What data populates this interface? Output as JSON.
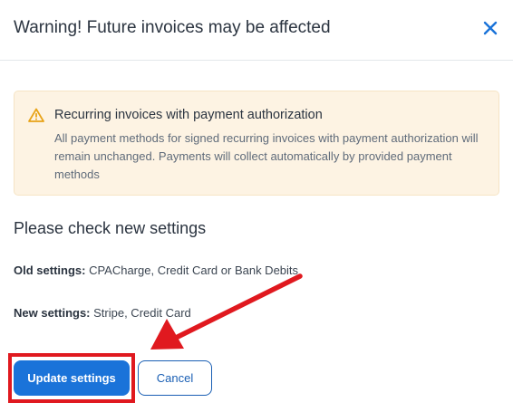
{
  "dialog": {
    "title": "Warning! Future invoices may be affected",
    "close_icon": "close-icon"
  },
  "alert": {
    "icon": "warning-triangle-icon",
    "title": "Recurring invoices with payment authorization",
    "body": "All payment methods for signed recurring invoices with payment authorization will remain unchanged. Payments will collect automatically by provided payment methods"
  },
  "settings": {
    "heading": "Please check new settings",
    "old_label": "Old settings:",
    "old_value": " CPACharge, Credit Card or Bank Debits",
    "new_label": "New settings:",
    "new_value": " Stripe, Credit Card"
  },
  "actions": {
    "update_label": "Update settings",
    "cancel_label": "Cancel"
  },
  "colors": {
    "primary": "#1a73d9",
    "warning_bg": "#fdf3e3",
    "warning_icon": "#e8a317",
    "annotation": "#e0191f"
  }
}
